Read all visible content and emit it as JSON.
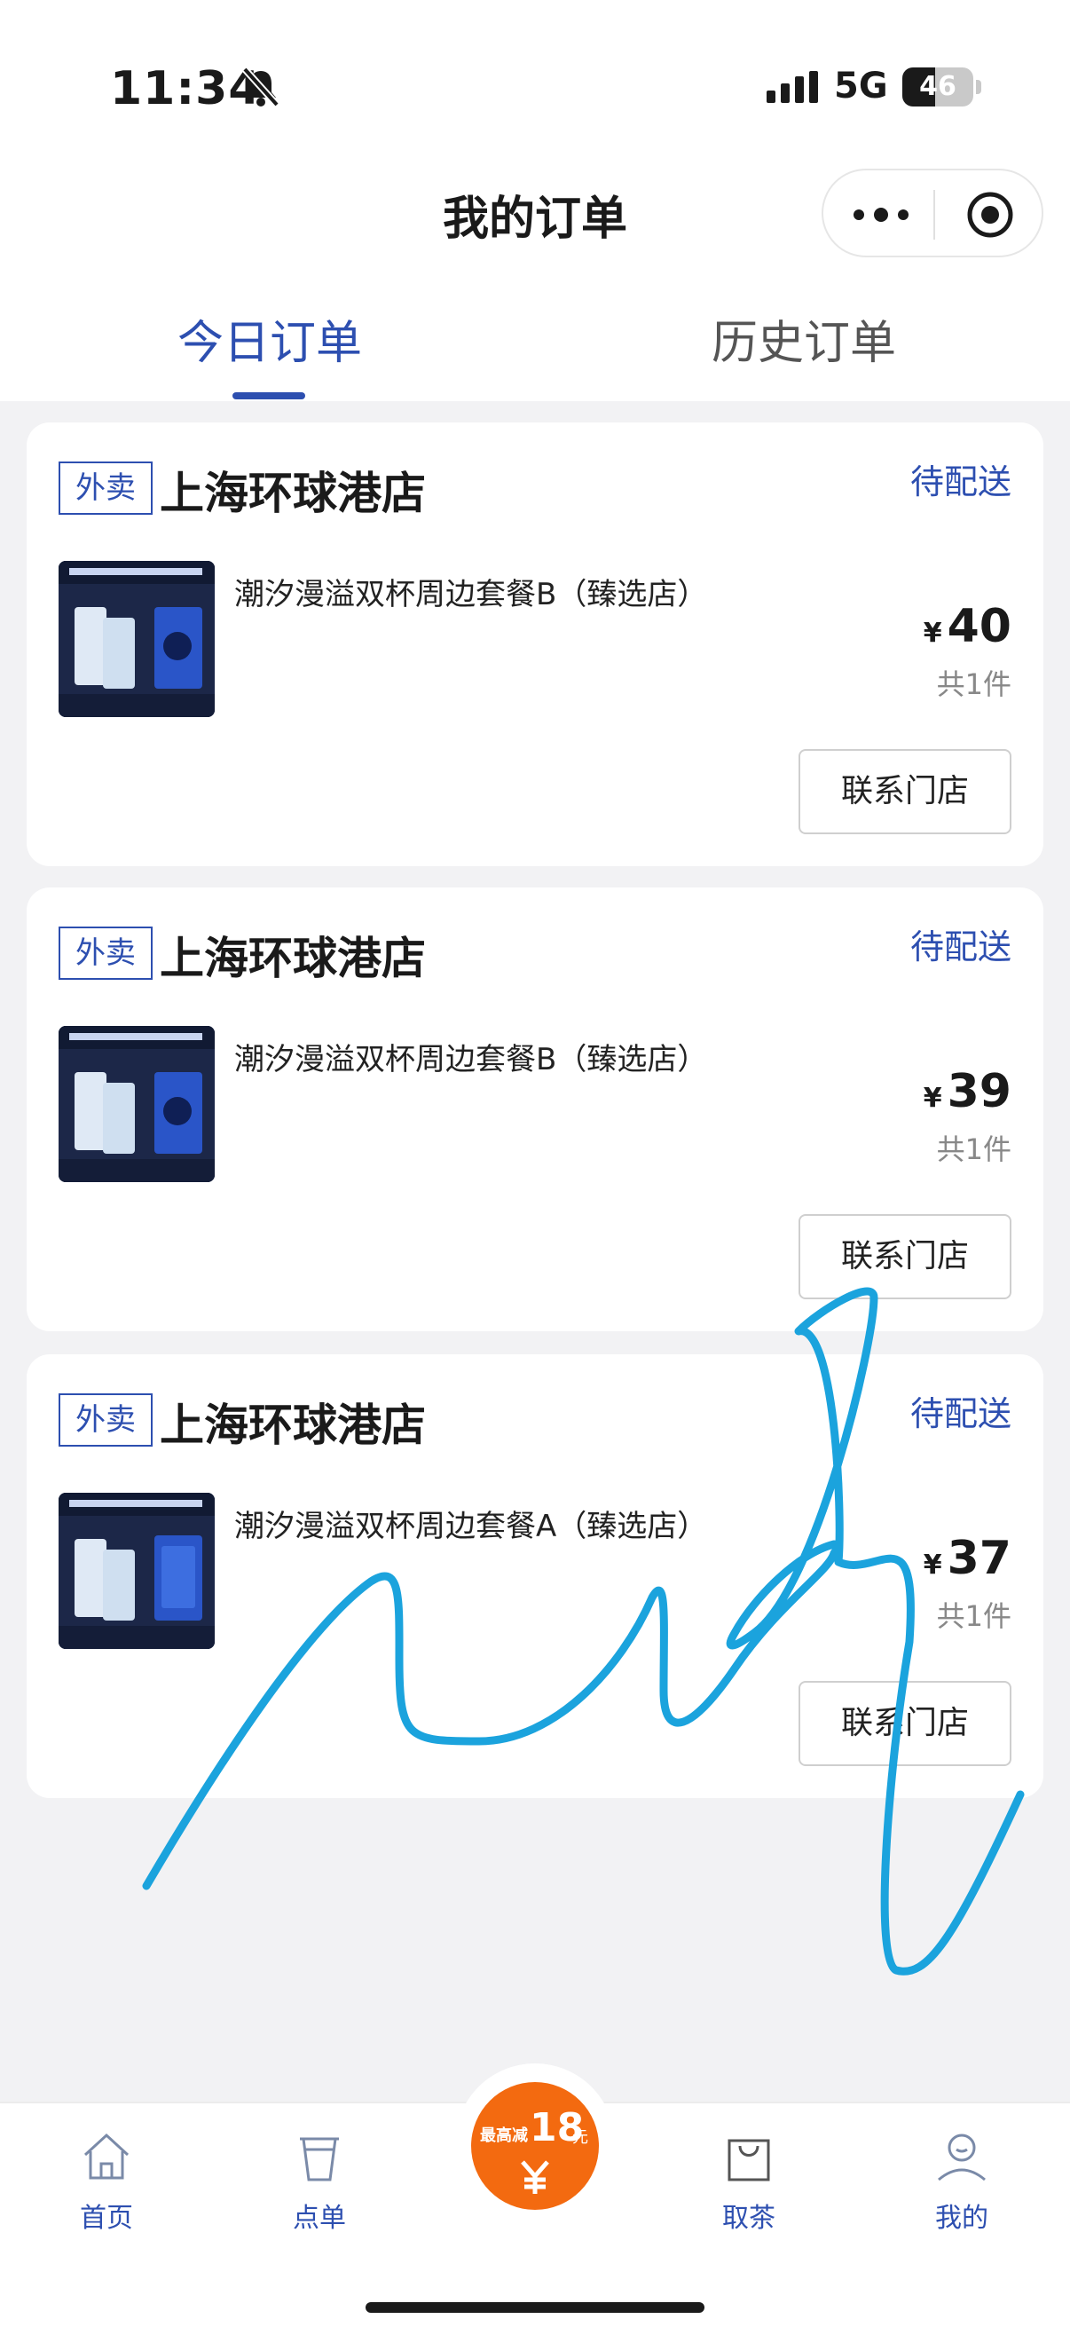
{
  "status_bar": {
    "time": "11:34",
    "network": "5G",
    "battery": "46",
    "battery_level": 0.46
  },
  "header": {
    "title": "我的订单"
  },
  "tabs": [
    {
      "label": "今日订单",
      "active": true
    },
    {
      "label": "历史订单",
      "active": false
    }
  ],
  "orders": [
    {
      "tag": "外卖",
      "store": "上海环球港店",
      "status": "待配送",
      "product": "潮汐漫溢双杯周边套餐B（臻选店）",
      "currency": "¥",
      "price": "40",
      "quantity": "共1件",
      "action": "联系门店"
    },
    {
      "tag": "外卖",
      "store": "上海环球港店",
      "status": "待配送",
      "product": "潮汐漫溢双杯周边套餐B（臻选店）",
      "currency": "¥",
      "price": "39",
      "quantity": "共1件",
      "action": "联系门店"
    },
    {
      "tag": "外卖",
      "store": "上海环球港店",
      "status": "待配送",
      "product": "潮汐漫溢双杯周边套餐A（臻选店）",
      "currency": "¥",
      "price": "37",
      "quantity": "共1件",
      "action": "联系门店"
    }
  ],
  "tabbar": {
    "items": [
      {
        "label": "首页",
        "icon": "home-icon"
      },
      {
        "label": "点单",
        "icon": "cup-icon"
      },
      {
        "label": "取茶",
        "icon": "bag-icon"
      },
      {
        "label": "我的",
        "icon": "profile-icon"
      }
    ],
    "promo": {
      "label": "最高减",
      "amount": "18",
      "unit": "元",
      "icon": "yen-icon"
    }
  },
  "colors": {
    "accent": "#2d4fb0",
    "promo": "#f36a10",
    "scribble": "#1ba3dd",
    "background": "#f2f2f4"
  }
}
